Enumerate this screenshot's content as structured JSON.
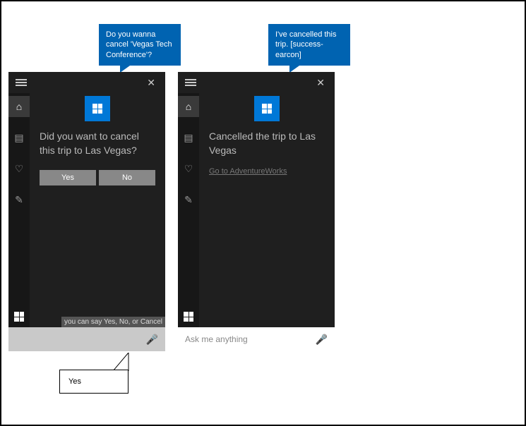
{
  "bubble_left": "Do you wanna cancel 'Vegas Tech Conference'?",
  "bubble_right": "I've cancelled this trip.\n[success-earcon]",
  "panel1": {
    "prompt": "Did you want to cancel this trip to Las Vegas?",
    "yes": "Yes",
    "no": "No",
    "hint": "you can say Yes, No, or Cancel"
  },
  "panel2": {
    "prompt": "Cancelled the trip to Las Vegas",
    "link": "Go to AdventureWorks",
    "placeholder": "Ask me anything"
  },
  "callout_yes": "Yes"
}
